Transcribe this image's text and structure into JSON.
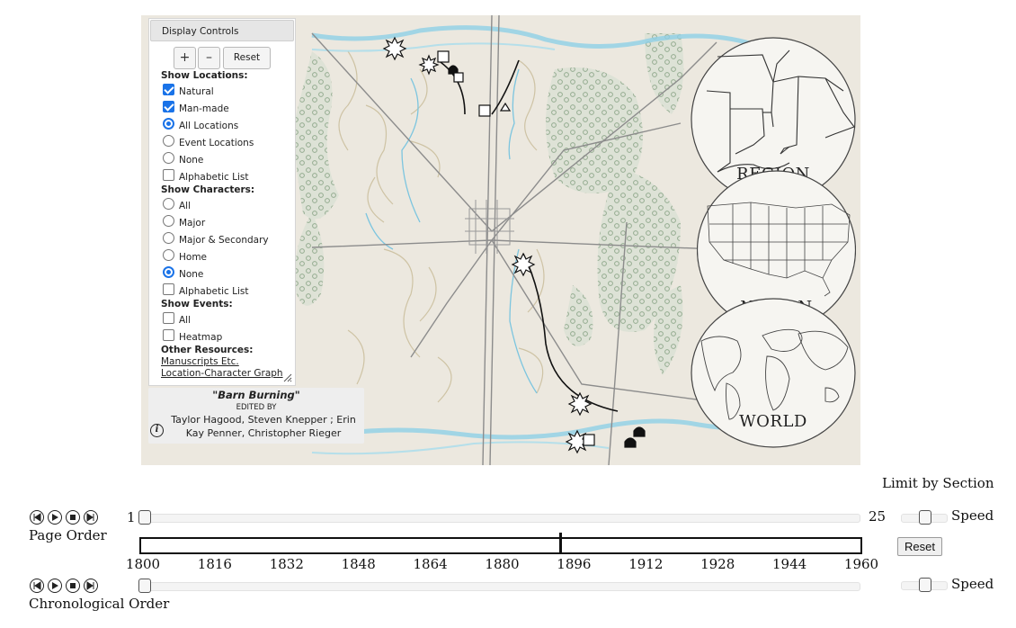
{
  "controls": {
    "title": "Display Controls",
    "zoom_in": "+",
    "zoom_out": "–",
    "reset": "Reset",
    "show_locations": {
      "heading": "Show Locations:",
      "natural": "Natural",
      "man_made": "Man-made",
      "all_locations": "All Locations",
      "event_locations": "Event Locations",
      "none": "None",
      "alphabetic_list": "Alphabetic List"
    },
    "show_characters": {
      "heading": "Show Characters:",
      "all": "All",
      "major": "Major",
      "major_secondary": "Major & Secondary",
      "home": "Home",
      "none": "None",
      "alphabetic_list": "Alphabetic List"
    },
    "show_events": {
      "heading": "Show Events:",
      "all": "All",
      "heatmap": "Heatmap"
    },
    "other_resources": {
      "heading": "Other Resources:",
      "manuscripts": "Manuscripts Etc.",
      "graph": "Location-Character Graph"
    },
    "state": {
      "natural": true,
      "man_made": true,
      "locations_mode": "All Locations",
      "locations_alpha": false,
      "characters_mode": "None",
      "characters_alpha": false,
      "events_all": false,
      "heatmap": false
    }
  },
  "credit": {
    "story": "\"Barn Burning\"",
    "edited_by": "EDITED BY",
    "editors_line1": "Taylor Hagood, Steven Knepper ; Erin",
    "editors_line2": "Kay Penner, Christopher Rieger",
    "info_glyph": "i"
  },
  "scale": {
    "region": "REGION",
    "nation": "NATION",
    "world": "WORLD"
  },
  "timeline": {
    "limit_by_section": "Limit by Section",
    "page_order": "Page Order",
    "chronological_order": "Chronological Order",
    "page_min": "1",
    "page_max": "25",
    "speed": "Speed",
    "reset": "Reset",
    "years": [
      "1800",
      "1816",
      "1832",
      "1848",
      "1864",
      "1880",
      "1896",
      "1912",
      "1928",
      "1944",
      "1960"
    ],
    "marker_year": 1893,
    "year_range": [
      1800,
      1960
    ],
    "page_value": 1,
    "chron_value": 0
  },
  "colors": {
    "map_bg": "#ece8df",
    "forest": "#9fb49a",
    "water": "#7fc6e0",
    "road": "#8a8a8a",
    "accent": "#1a73e8"
  },
  "icons": {
    "first": "skip-first-icon",
    "play": "play-icon",
    "stop": "stop-icon",
    "last": "skip-last-icon"
  }
}
